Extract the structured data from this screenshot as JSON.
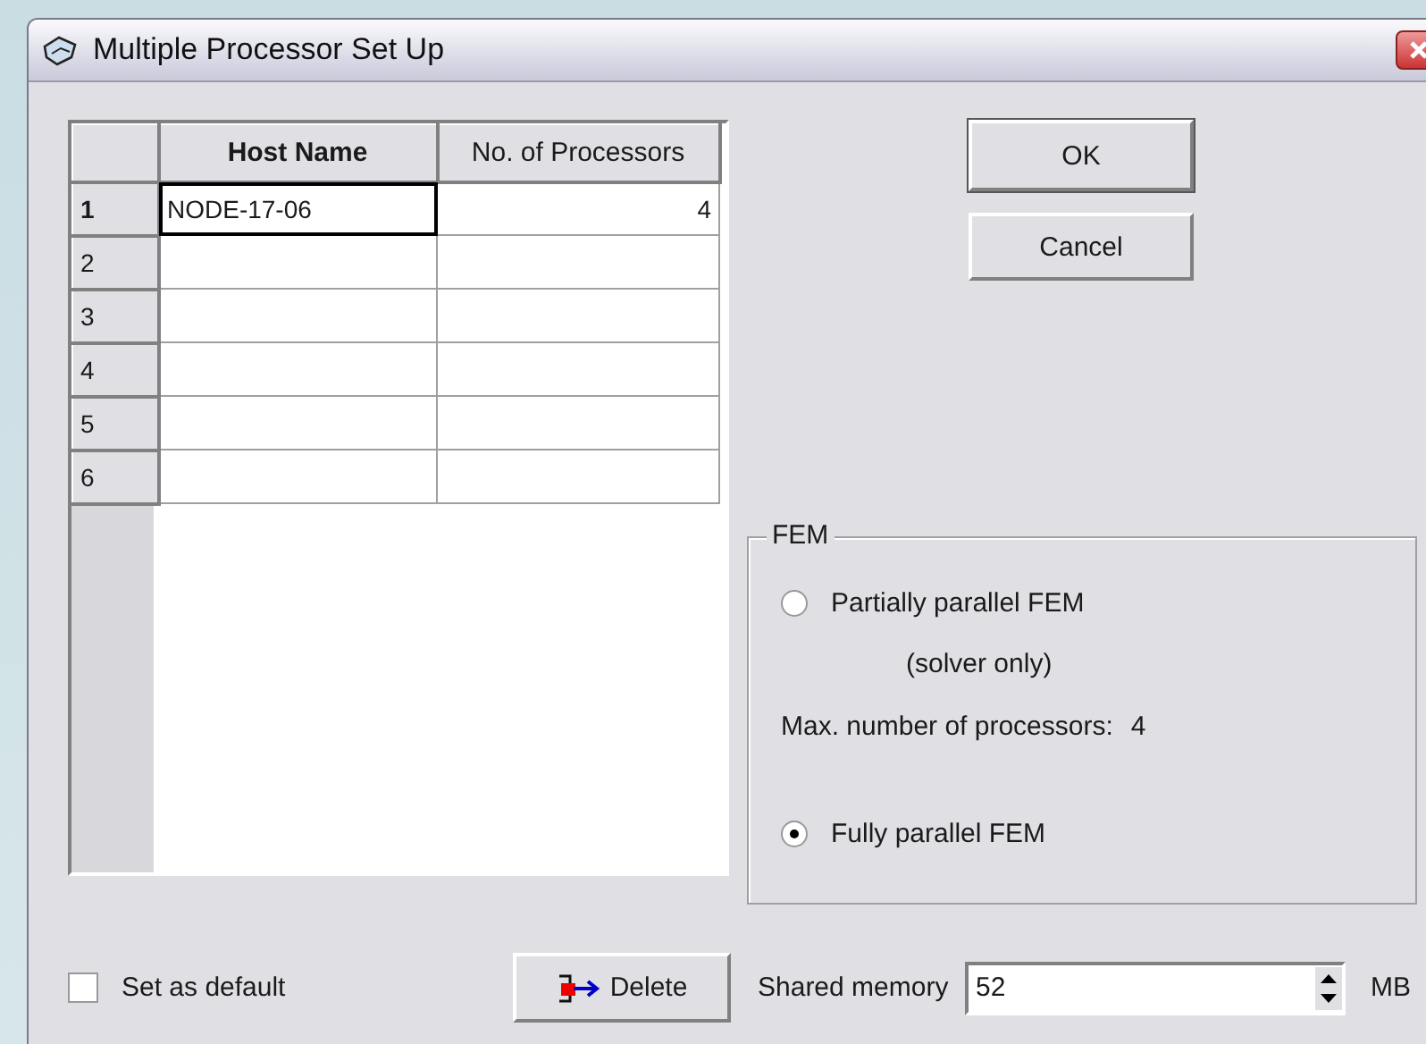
{
  "window": {
    "title": "Multiple Processor Set Up"
  },
  "grid": {
    "columns": [
      "Host Name",
      "No. of Processors"
    ],
    "rows": [
      {
        "index": "1",
        "host_name": "NODE-17-06",
        "processors": "4",
        "selected": true
      },
      {
        "index": "2",
        "selected": false
      },
      {
        "index": "3",
        "selected": false
      },
      {
        "index": "4",
        "selected": false
      },
      {
        "index": "5",
        "selected": false
      },
      {
        "index": "6",
        "selected": false
      }
    ]
  },
  "buttons": [
    {
      "label": "OK",
      "default": true
    },
    {
      "label": "Cancel",
      "default": false
    }
  ],
  "fem": {
    "title": "FEM",
    "options": [
      {
        "label": "Partially parallel FEM",
        "selected": false
      },
      {
        "label": "Fully parallel FEM",
        "selected": true
      }
    ],
    "note": "(solver only)",
    "max_label": "Max. number of processors:",
    "max_value": "4"
  },
  "set_default": {
    "label": "Set as default",
    "checked": false
  },
  "delete_button": {
    "label": "Delete"
  },
  "shared_memory": {
    "label": "Shared memory",
    "value": "52",
    "unit": "MB"
  }
}
